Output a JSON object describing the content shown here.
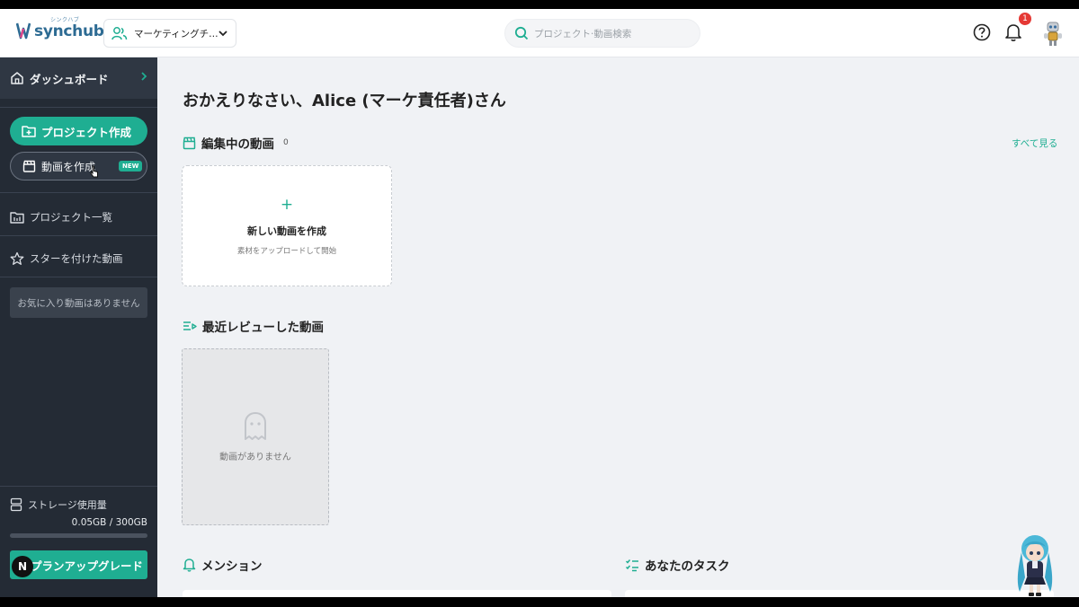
{
  "brand": {
    "name": "synchub",
    "kana": "シンクハブ",
    "accent": "#1fae92"
  },
  "header": {
    "team_select": {
      "icon": "users-icon",
      "value": "マーケティングチ…"
    },
    "search": {
      "icon": "search-icon",
      "placeholder": "プロジェクト·動画検索"
    },
    "help_icon": "help-circle-icon",
    "notifications": {
      "icon": "bell-icon",
      "count": "1"
    },
    "avatar": "robot-avatar"
  },
  "sidebar": {
    "dashboard": {
      "icon": "home-icon",
      "label": "ダッシュボード"
    },
    "create_project": {
      "icon": "folder-plus-icon",
      "label": "プロジェクト作成"
    },
    "create_video": {
      "icon": "clapperboard-icon",
      "label": "動画を作成",
      "badge": "NEW"
    },
    "projects": {
      "icon": "project-list-icon",
      "label": "プロジェクト一覧"
    },
    "starred": {
      "icon": "star-icon",
      "label": "スターを付けた動画",
      "empty": "お気に入り動画はありません"
    },
    "storage": {
      "icon": "storage-icon",
      "label": "ストレージ使用量",
      "value": "0.05GB / 300GB",
      "used_fraction": 0.0002
    },
    "upgrade": {
      "label": "プランアップグレード",
      "floating_badge": "N"
    }
  },
  "main": {
    "greeting": "おかえりなさい、Alice (マーケ責任者)さん",
    "editing": {
      "icon": "clapperboard-icon",
      "title": "編集中の動画",
      "count": "0",
      "see_all": "すべて見る",
      "new_card": {
        "plus": "+",
        "title": "新しい動画を作成",
        "subtitle": "素材をアップロードして開始"
      }
    },
    "recent": {
      "icon": "review-list-icon",
      "title": "最近レビューした動画",
      "empty": "動画がありません"
    },
    "mentions": {
      "icon": "bell-icon",
      "title": "メンション"
    },
    "tasks": {
      "icon": "checklist-icon",
      "title": "あなたのタスク"
    }
  }
}
